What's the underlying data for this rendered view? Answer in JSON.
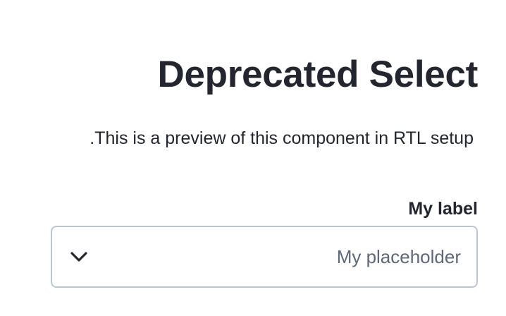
{
  "header": {
    "title": "Deprecated Select",
    "subtitle": "This is a preview of this component in RTL setup."
  },
  "select": {
    "label": "My label",
    "placeholder": "My placeholder",
    "icon": "chevron-down-icon"
  },
  "colors": {
    "text": "#23262e",
    "placeholder": "#5e6878",
    "border": "#bcc6d2",
    "background": "#ffffff"
  }
}
